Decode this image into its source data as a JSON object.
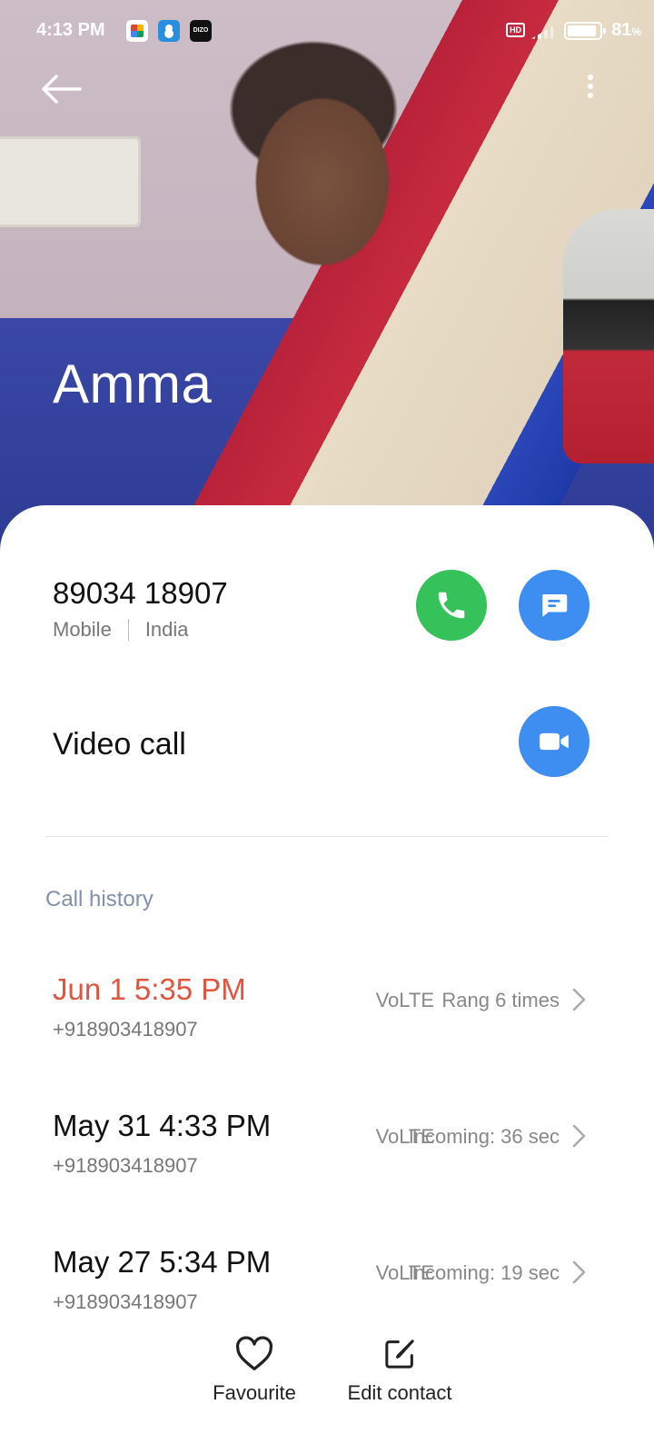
{
  "status_bar": {
    "time": "4:13 PM",
    "app_icons": [
      "play-games-icon",
      "contacts-app-icon",
      "dizo-app-icon"
    ],
    "dizo_label": "DIZO",
    "battery_percent": "81",
    "battery_unit": "%"
  },
  "contact": {
    "name": "Amma"
  },
  "phone": {
    "number": "89034 18907",
    "type": "Mobile",
    "country": "India"
  },
  "video": {
    "label": "Video call"
  },
  "history": {
    "title": "Call history",
    "rows": [
      {
        "date": "Jun 1 5:35 PM",
        "number": "+918903418907",
        "network": "VoLTE",
        "detail": "Rang 6 times",
        "missed": true
      },
      {
        "date": "May 31 4:33 PM",
        "number": "+918903418907",
        "network": "VoLTE",
        "detail": "Incoming: 36 sec",
        "missed": false
      },
      {
        "date": "May 27 5:34 PM",
        "number": "+918903418907",
        "network": "VoLTE",
        "detail": "Incoming: 19 sec",
        "missed": false
      }
    ]
  },
  "bottom_bar": {
    "favourite_label": "Favourite",
    "edit_label": "Edit contact"
  },
  "colors": {
    "call_green": "#36c25b",
    "action_blue": "#3d8ef0",
    "missed_red": "#e0553f",
    "section_title": "#8290ad"
  }
}
